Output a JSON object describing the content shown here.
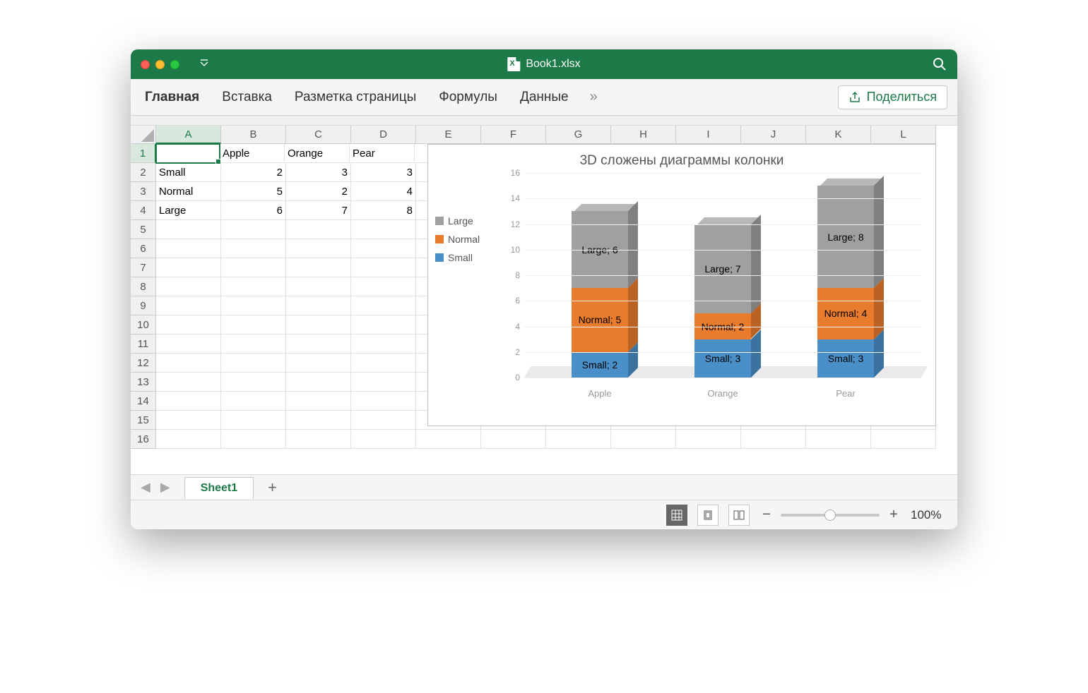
{
  "titlebar": {
    "filename": "Book1.xlsx"
  },
  "ribbon": {
    "tabs": [
      "Главная",
      "Вставка",
      "Разметка страницы",
      "Формулы",
      "Данные"
    ],
    "share": "Поделиться"
  },
  "columns": [
    "A",
    "B",
    "C",
    "D",
    "E",
    "F",
    "G",
    "H",
    "I",
    "J",
    "K",
    "L"
  ],
  "row_count": 16,
  "active_cell": "A1",
  "table": {
    "headers": [
      "",
      "Apple",
      "Orange",
      "Pear"
    ],
    "rows": [
      {
        "label": "Small",
        "vals": [
          2,
          3,
          3
        ]
      },
      {
        "label": "Normal",
        "vals": [
          5,
          2,
          4
        ]
      },
      {
        "label": "Large",
        "vals": [
          6,
          7,
          8
        ]
      }
    ]
  },
  "chart_data": {
    "type": "bar",
    "stacked": true,
    "title": "3D сложены диаграммы колонки",
    "categories": [
      "Apple",
      "Orange",
      "Pear"
    ],
    "series": [
      {
        "name": "Small",
        "color": "#4a8fc7",
        "values": [
          2,
          3,
          3
        ]
      },
      {
        "name": "Normal",
        "color": "#e87b2c",
        "values": [
          5,
          2,
          4
        ]
      },
      {
        "name": "Large",
        "color": "#a0a0a0",
        "values": [
          6,
          7,
          8
        ]
      }
    ],
    "legend_order": [
      "Large",
      "Normal",
      "Small"
    ],
    "yticks": [
      0,
      2,
      4,
      6,
      8,
      10,
      12,
      14,
      16
    ],
    "ylim": [
      0,
      16
    ],
    "xlabel": "",
    "ylabel": "",
    "data_labels": true
  },
  "sheets": {
    "active": "Sheet1"
  },
  "status": {
    "zoom": "100%"
  },
  "colors": {
    "small": "#4a8fc7",
    "normal": "#e87b2c",
    "large": "#a0a0a0"
  }
}
